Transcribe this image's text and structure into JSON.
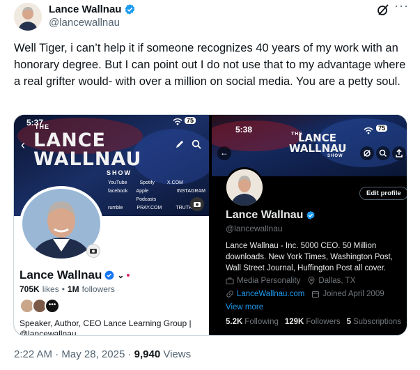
{
  "author": {
    "name": "Lance Wallnau",
    "handle": "@lancewallnau"
  },
  "tweet": {
    "text": "Well Tiger, i can’t help it if someone recognizes 40 years of my work with an honorary degree. But I can point out I do not use that to my advantage where a real grifter would- with over a million on social media. You are a petty soul."
  },
  "left_shot": {
    "time": "5:37",
    "battery": "75",
    "banner_line1": "THE",
    "banner_line2": "LANCE",
    "banner_line3": "WALLNAU",
    "banner_line4": "SHOW",
    "badges": [
      "YouTube",
      "facebook",
      "rumble",
      "Spotify",
      "Apple Podcasts",
      "PRAY.COM",
      "X.COM",
      "INSTAGRAM",
      "TRUTH"
    ],
    "name": "Lance Wallnau",
    "likes_count": "705K",
    "likes_label": "likes",
    "followers_count": "1M",
    "followers_label": "followers",
    "bio": "Speaker, Author, CEO Lance Learning Group |",
    "bio_handle": "@lancewallnau"
  },
  "right_shot": {
    "time": "5:38",
    "battery": "75",
    "banner_line1": "THE",
    "banner_line2": "LANCE",
    "banner_line3": "WALLNAU",
    "banner_line4": "SHOW",
    "edit_profile": "Edit profile",
    "name": "Lance Wallnau",
    "handle": "@lancewallnau",
    "bio_line1": "Lance Wallnau - Inc. 5000 CEO. 50 Million",
    "bio_line2": "downloads. New York Times, Washington Post,",
    "bio_line3": "Wall Street Journal, Huffington Post all cover.",
    "category": "Media Personality",
    "location": "Dallas, TX",
    "website": "LanceWallnau.com",
    "joined": "Joined April 2009",
    "view_more": "View more",
    "following_count": "5.2K",
    "following_label": "Following",
    "followers_count": "129K",
    "followers_label": "Followers",
    "subs_count": "5",
    "subs_label": "Subscriptions"
  },
  "footer": {
    "time": "2:22 AM",
    "sep": "·",
    "date": "May 28, 2025",
    "views_count": "9,940",
    "views_label": "Views"
  },
  "colors": {
    "verified": "#1d9bf0",
    "link": "#1d9bf0",
    "muted": "#536471"
  }
}
